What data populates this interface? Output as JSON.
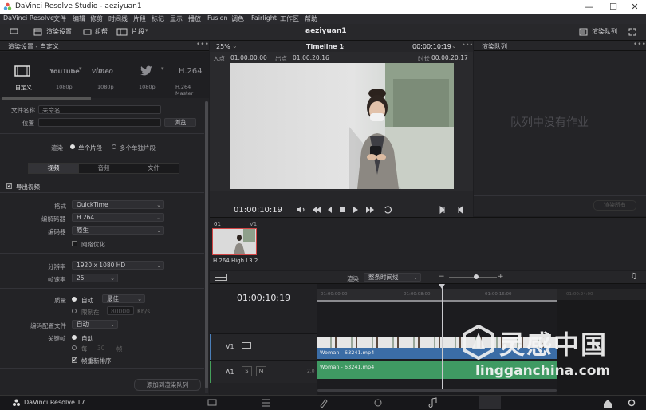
{
  "window": {
    "title": "DaVinci Resolve Studio - aeziyuan1",
    "minimize": "—",
    "maximize": "☐",
    "close": "✕"
  },
  "menu": [
    "DaVinci Resolve",
    "文件",
    "编辑",
    "修剪",
    "时间线",
    "片段",
    "标记",
    "显示",
    "播放",
    "Fusion",
    "调色",
    "Fairlight",
    "工作区",
    "帮助"
  ],
  "toolbar": {
    "render_settings": "渲染设置",
    "clips": "组帮",
    "edit_clips": "片段",
    "project": "aeziyuan1",
    "render_queue": "渲染队列"
  },
  "left": {
    "header": "渲染设置 - 自定义",
    "presets": [
      {
        "name": "自定义",
        "sub": ""
      },
      {
        "name": "YouTube",
        "sub": "1080p"
      },
      {
        "name": "vimeo",
        "sub": "1080p"
      },
      {
        "name": "twitter",
        "sub": "1080p"
      },
      {
        "name": "H.264",
        "sub": "H.264 Master"
      }
    ],
    "filename_label": "文件名称",
    "filename_value": "未命名",
    "location_label": "位置",
    "browse": "浏览",
    "render_label": "渲染",
    "single_clip": "单个片段",
    "multi_clip": "多个单独片段",
    "tabs": [
      "视频",
      "音频",
      "文件"
    ],
    "export_video": "导出视频",
    "format_label": "格式",
    "format_value": "QuickTime",
    "codec_label": "编解码器",
    "codec_value": "H.264",
    "encoder_label": "编码器",
    "encoder_value": "原生",
    "network_opt": "网络优化",
    "resolution_label": "分辨率",
    "resolution_value": "1920 x 1080 HD",
    "framerate_label": "帧速率",
    "framerate_value": "25",
    "quality_label": "质量",
    "auto": "自动",
    "best": "最佳",
    "limit": "限制在",
    "kbs_value": "80000",
    "kbs_unit": "Kb/s",
    "encode_profile_label": "编码配置文件",
    "encode_profile_value": "自动",
    "keyframe_label": "关键帧",
    "kf_auto": "自动",
    "kf_every": "每",
    "kf_num": "30",
    "kf_frames": "帧",
    "reorder": "帧重新排序",
    "add_queue": "添加到渲染队列"
  },
  "viewer": {
    "zoom": "25%",
    "timeline_name": "Timeline 1",
    "timecode_top": "00:00:10:19",
    "in_label": "入点",
    "in_value": "01:00:00:00",
    "out_label": "出点",
    "out_value": "01:00:20:16",
    "dur_label": "时长",
    "dur_value": "00:00:20:17",
    "timecode": "01:00:10:19"
  },
  "queue": {
    "header": "渲染队列",
    "empty": "队列中没有作业",
    "render_all": "渲染所有"
  },
  "clip": {
    "index": "01",
    "track": "V1",
    "label": "H.264 High L3.2"
  },
  "timeline": {
    "render_label": "渲染",
    "render_scope": "整条时间线",
    "timecode": "01:00:10:19",
    "ruler": [
      "01:00:00:00",
      "01:00:08:00",
      "01:00:16:00",
      "01:00:24:00"
    ],
    "v1": "V1",
    "a1": "A1",
    "s": "S",
    "m": "M",
    "ch": "2.0",
    "video_clip": "Woman - 63241.mp4",
    "audio_clip": "Woman - 63241.mp4"
  },
  "bottom": {
    "app": "DaVinci Resolve 17"
  },
  "watermark": {
    "brand": "灵感中国",
    "url": "lingganchina.com"
  }
}
